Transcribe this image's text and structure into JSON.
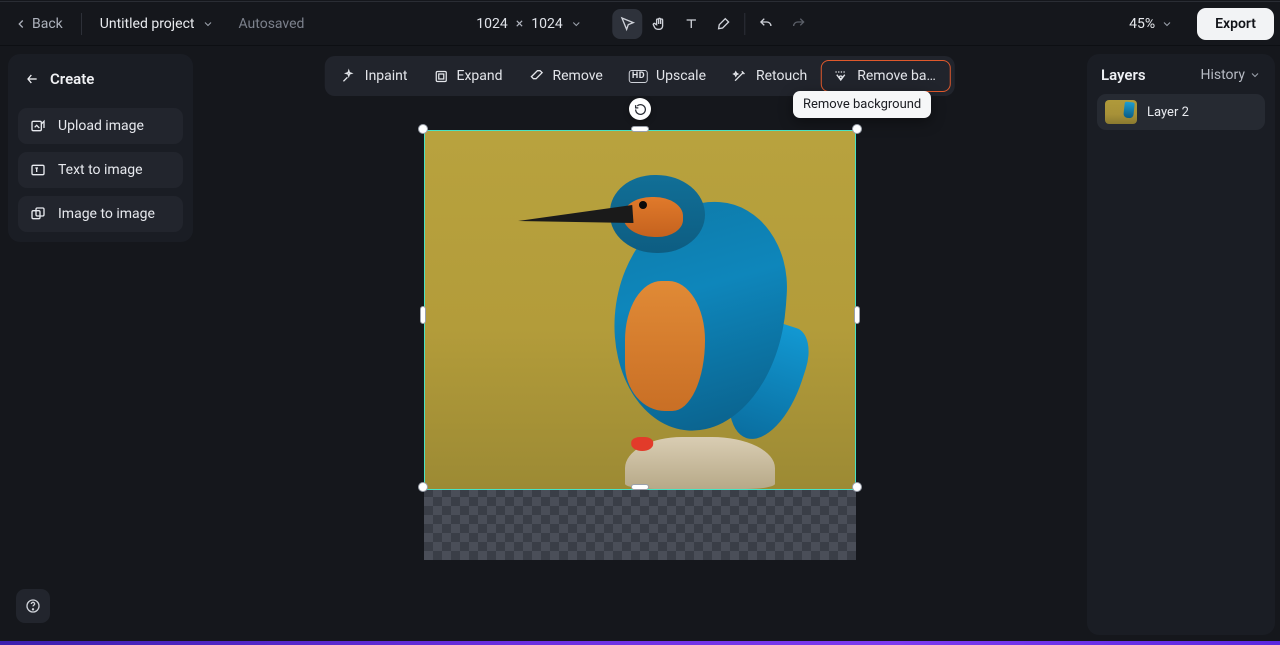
{
  "topbar": {
    "back": "Back",
    "project_name": "Untitled project",
    "autosaved": "Autosaved",
    "dims_w": "1024",
    "dims_h": "1024",
    "zoom": "45%",
    "export": "Export"
  },
  "tools": {
    "select": "select",
    "pan": "pan",
    "text": "text",
    "brush": "brush",
    "undo": "undo",
    "redo": "redo"
  },
  "create": {
    "title": "Create",
    "upload": "Upload image",
    "t2i": "Text to image",
    "i2i": "Image to image"
  },
  "actions": {
    "inpaint": "Inpaint",
    "expand": "Expand",
    "remove": "Remove",
    "upscale": "Upscale",
    "upscale_badge": "HD",
    "retouch": "Retouch",
    "remove_bg_short": "Remove back…",
    "remove_bg_tooltip": "Remove background"
  },
  "layers": {
    "title": "Layers",
    "history": "History",
    "items": [
      {
        "label": "Layer 2"
      }
    ]
  },
  "colors": {
    "highlight_border": "#e0592c",
    "selection_border": "#49e3c2"
  }
}
